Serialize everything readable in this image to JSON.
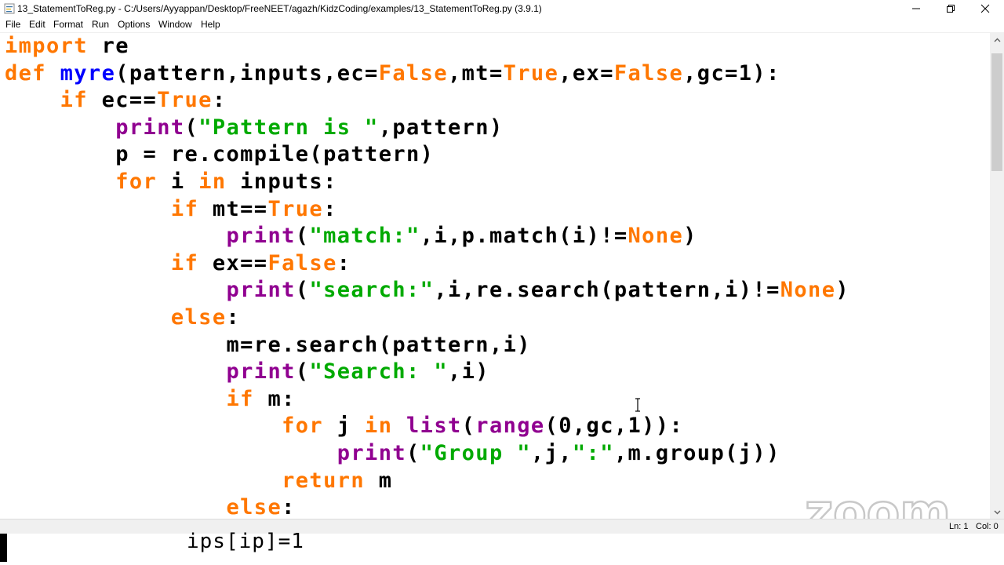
{
  "window": {
    "title": "13_StatementToReg.py - C:/Users/Ayyappan/Desktop/FreeNEET/agazh/KidzCoding/examples/13_StatementToReg.py (3.9.1)"
  },
  "menu": {
    "file": {
      "label": "File"
    },
    "edit": {
      "label": "Edit"
    },
    "format": {
      "label": "Format"
    },
    "run": {
      "label": "Run"
    },
    "options": {
      "label": "Options"
    },
    "window": {
      "label": "Window"
    },
    "help": {
      "label": "Help"
    }
  },
  "syntax_colors": {
    "keyword": "#ff7700",
    "builtin": "#900090",
    "string": "#00aa00",
    "definition": "#0000ff",
    "default": "#000000"
  },
  "code_lines": [
    [
      {
        "t": "import",
        "c": "kw"
      },
      {
        "t": " re",
        "c": "tx"
      }
    ],
    [
      {
        "t": "def",
        "c": "kw"
      },
      {
        "t": " ",
        "c": "tx"
      },
      {
        "t": "myre",
        "c": "df"
      },
      {
        "t": "(pattern,inputs,ec=",
        "c": "tx"
      },
      {
        "t": "False",
        "c": "kw"
      },
      {
        "t": ",mt=",
        "c": "tx"
      },
      {
        "t": "True",
        "c": "kw"
      },
      {
        "t": ",ex=",
        "c": "tx"
      },
      {
        "t": "False",
        "c": "kw"
      },
      {
        "t": ",gc=1):",
        "c": "tx"
      }
    ],
    [
      {
        "t": "    ",
        "c": "tx"
      },
      {
        "t": "if",
        "c": "kw"
      },
      {
        "t": " ec==",
        "c": "tx"
      },
      {
        "t": "True",
        "c": "kw"
      },
      {
        "t": ":",
        "c": "tx"
      }
    ],
    [
      {
        "t": "        ",
        "c": "tx"
      },
      {
        "t": "print",
        "c": "bi"
      },
      {
        "t": "(",
        "c": "tx"
      },
      {
        "t": "\"Pattern is \"",
        "c": "st"
      },
      {
        "t": ",pattern)",
        "c": "tx"
      }
    ],
    [
      {
        "t": "        p = re.compile(pattern)",
        "c": "tx"
      }
    ],
    [
      {
        "t": "        ",
        "c": "tx"
      },
      {
        "t": "for",
        "c": "kw"
      },
      {
        "t": " i ",
        "c": "tx"
      },
      {
        "t": "in",
        "c": "kw"
      },
      {
        "t": " inputs:",
        "c": "tx"
      }
    ],
    [
      {
        "t": "            ",
        "c": "tx"
      },
      {
        "t": "if",
        "c": "kw"
      },
      {
        "t": " mt==",
        "c": "tx"
      },
      {
        "t": "True",
        "c": "kw"
      },
      {
        "t": ":",
        "c": "tx"
      }
    ],
    [
      {
        "t": "                ",
        "c": "tx"
      },
      {
        "t": "print",
        "c": "bi"
      },
      {
        "t": "(",
        "c": "tx"
      },
      {
        "t": "\"match:\"",
        "c": "st"
      },
      {
        "t": ",i,p.match(i)!=",
        "c": "tx"
      },
      {
        "t": "None",
        "c": "kw"
      },
      {
        "t": ")",
        "c": "tx"
      }
    ],
    [
      {
        "t": "            ",
        "c": "tx"
      },
      {
        "t": "if",
        "c": "kw"
      },
      {
        "t": " ex==",
        "c": "tx"
      },
      {
        "t": "False",
        "c": "kw"
      },
      {
        "t": ":",
        "c": "tx"
      }
    ],
    [
      {
        "t": "                ",
        "c": "tx"
      },
      {
        "t": "print",
        "c": "bi"
      },
      {
        "t": "(",
        "c": "tx"
      },
      {
        "t": "\"search:\"",
        "c": "st"
      },
      {
        "t": ",i,re.search(pattern,i)!=",
        "c": "tx"
      },
      {
        "t": "None",
        "c": "kw"
      },
      {
        "t": ")",
        "c": "tx"
      }
    ],
    [
      {
        "t": "            ",
        "c": "tx"
      },
      {
        "t": "else",
        "c": "kw"
      },
      {
        "t": ":",
        "c": "tx"
      }
    ],
    [
      {
        "t": "                m=re.search(pattern,i)",
        "c": "tx"
      }
    ],
    [
      {
        "t": "                ",
        "c": "tx"
      },
      {
        "t": "print",
        "c": "bi"
      },
      {
        "t": "(",
        "c": "tx"
      },
      {
        "t": "\"Search: \"",
        "c": "st"
      },
      {
        "t": ",i)",
        "c": "tx"
      }
    ],
    [
      {
        "t": "                ",
        "c": "tx"
      },
      {
        "t": "if",
        "c": "kw"
      },
      {
        "t": " m:",
        "c": "tx"
      }
    ],
    [
      {
        "t": "                    ",
        "c": "tx"
      },
      {
        "t": "for",
        "c": "kw"
      },
      {
        "t": " j ",
        "c": "tx"
      },
      {
        "t": "in",
        "c": "kw"
      },
      {
        "t": " ",
        "c": "tx"
      },
      {
        "t": "list",
        "c": "bi"
      },
      {
        "t": "(",
        "c": "tx"
      },
      {
        "t": "range",
        "c": "bi"
      },
      {
        "t": "(0,gc,1)):",
        "c": "tx"
      }
    ],
    [
      {
        "t": "                        ",
        "c": "tx"
      },
      {
        "t": "print",
        "c": "bi"
      },
      {
        "t": "(",
        "c": "tx"
      },
      {
        "t": "\"Group \"",
        "c": "st"
      },
      {
        "t": ",j,",
        "c": "tx"
      },
      {
        "t": "\":\"",
        "c": "st"
      },
      {
        "t": ",m.group(j))",
        "c": "tx"
      }
    ],
    [
      {
        "t": "                    ",
        "c": "tx"
      },
      {
        "t": "return",
        "c": "kw"
      },
      {
        "t": " m",
        "c": "tx"
      }
    ],
    [
      {
        "t": "                ",
        "c": "tx"
      },
      {
        "t": "else",
        "c": "kw"
      },
      {
        "t": ":",
        "c": "tx"
      }
    ]
  ],
  "status": {
    "line": "Ln: 1",
    "col": "Col: 0"
  },
  "terminal": {
    "text": "ips[ip]=1"
  },
  "watermark": {
    "text": "zoom"
  }
}
